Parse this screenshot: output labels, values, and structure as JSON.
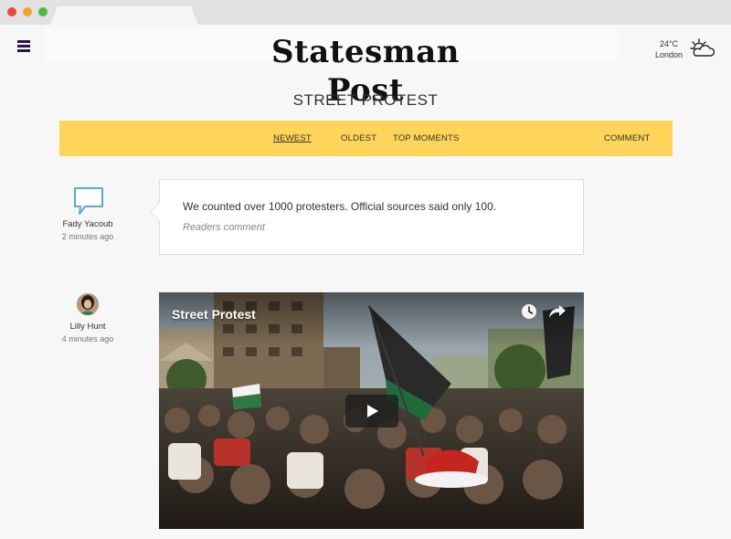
{
  "masthead": {
    "title": "Statesman Post"
  },
  "weather": {
    "temperature": "24°C",
    "city": "London",
    "icon": "partly-cloudy-icon"
  },
  "page": {
    "title": "STREET PROTEST"
  },
  "nav": {
    "newest": "NEWEST",
    "oldest": "OLDEST",
    "top_moments": "TOP MOMENTS",
    "comment": "COMMENT",
    "active": "newest"
  },
  "entries": [
    {
      "author": "Fady Yacoub",
      "time": "2 minutes ago",
      "icon": "speech-bubble-icon",
      "text": "We counted over 1000 protesters. Official sources said only 100.",
      "meta": "Readers comment"
    },
    {
      "author": "Lilly Hunt",
      "time": "4 minutes ago",
      "video_title": "Street Protest"
    }
  ],
  "colors": {
    "nav_background": "#fed559",
    "accent_icon": "#5aa9d6",
    "menu_icon": "#2a1646"
  }
}
